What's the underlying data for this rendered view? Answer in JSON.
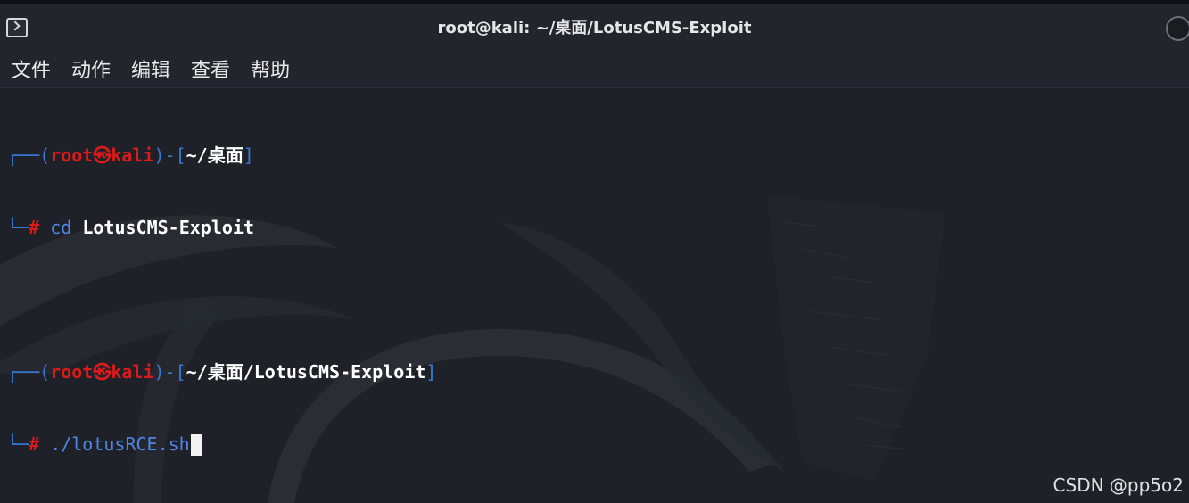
{
  "window": {
    "title": "root@kali: ~/桌面/LotusCMS-Exploit"
  },
  "menu": {
    "items": [
      "文件",
      "动作",
      "编辑",
      "查看",
      "帮助"
    ]
  },
  "terminal": {
    "prompts": [
      {
        "open": "┌──(",
        "user": "root",
        "at": "㉿",
        "host": "kali",
        "mid": ")-[",
        "path": "~/桌面",
        "close": "]",
        "hash_prefix": "└─",
        "hash": "#",
        "command_prefix": " ",
        "command_keyword": "cd",
        "command_arg": "LotusCMS-Exploit"
      },
      {
        "open": "┌──(",
        "user": "root",
        "at": "㉿",
        "host": "kali",
        "mid": ")-[",
        "path": "~/桌面/LotusCMS-Exploit",
        "close": "]",
        "hash_prefix": "└─",
        "hash": "#",
        "command_prefix": " ",
        "command": "./lotusRCE.sh"
      }
    ]
  },
  "watermark": "CSDN @pp5o2",
  "colors": {
    "background": "#1e2127",
    "prompt_blue": "#3a78d8",
    "prompt_red": "#d81b1b",
    "command_blue": "#4f86e6"
  }
}
